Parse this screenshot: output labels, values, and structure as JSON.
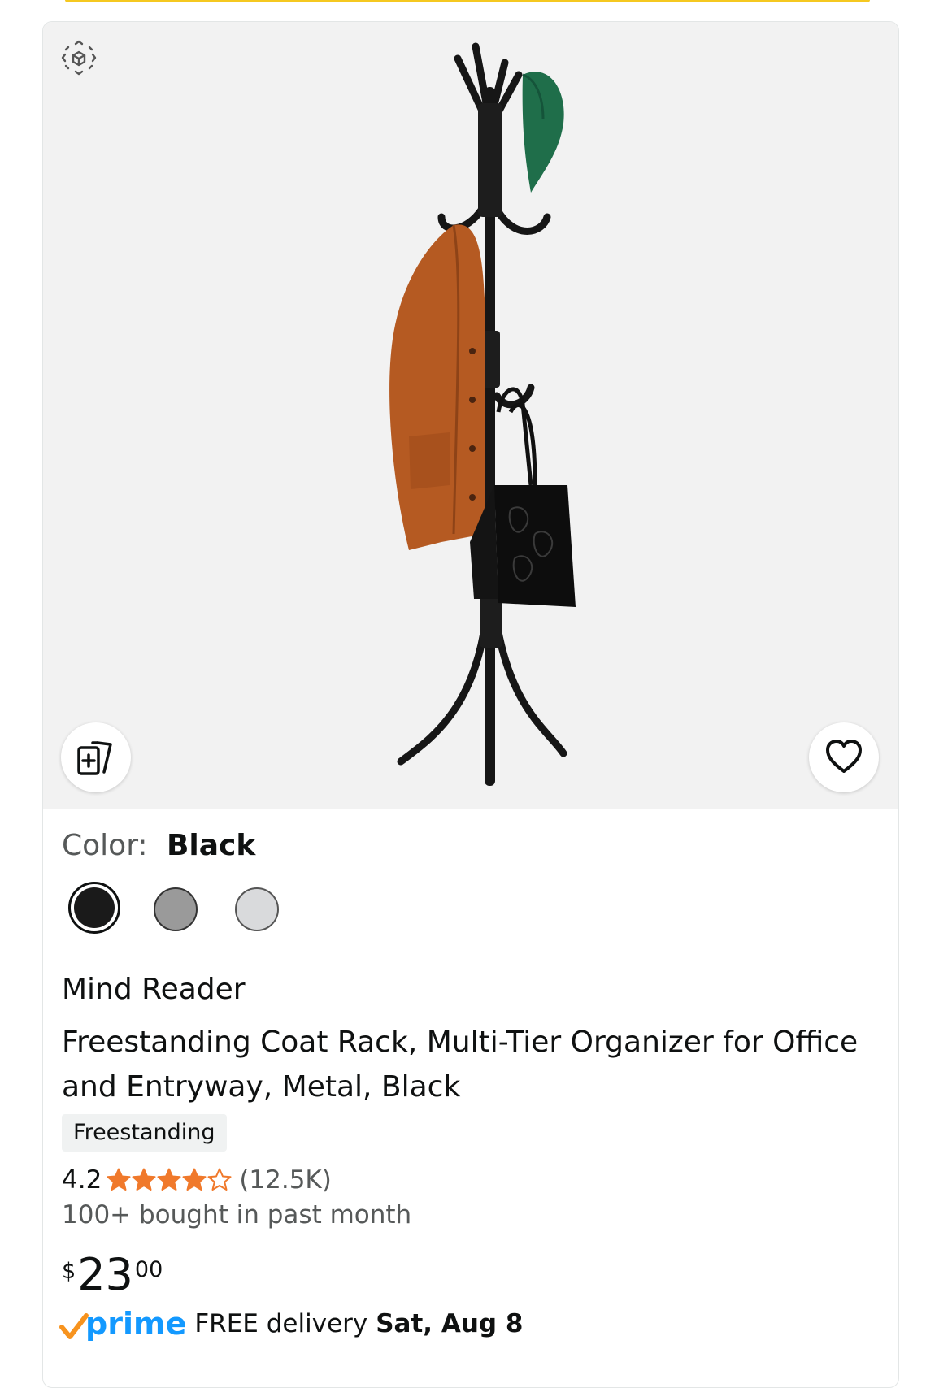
{
  "color_selector": {
    "label": "Color:",
    "selected": "Black",
    "options": [
      {
        "name": "Black",
        "hex": "#1a1a1a"
      },
      {
        "name": "Gray",
        "hex": "#9a9a9a"
      },
      {
        "name": "Light Gray",
        "hex": "#d9dadc"
      }
    ]
  },
  "product": {
    "brand": "Mind Reader",
    "title": "Freestanding Coat Rack, Multi-Tier Organizer for Office and Entryway, Metal, Black",
    "badge": "Freestanding",
    "rating": "4.2",
    "rating_value": 4.2,
    "rating_max": 5,
    "review_count": "(12.5K)",
    "bought": "100+ bought in past month"
  },
  "price": {
    "symbol": "$",
    "whole": "23",
    "fraction": "00"
  },
  "delivery": {
    "prime": "prime",
    "text": "FREE delivery",
    "date": "Sat, Aug 8"
  },
  "icons": [
    "view-in-3d-icon",
    "add-to-compare-icon",
    "heart-icon",
    "star-icon",
    "prime-check-icon"
  ],
  "colors": {
    "star": "#f0792b",
    "prime_blue": "#1399ff",
    "prime_check": "#f7931e",
    "highlight_bar": "#f5c820"
  }
}
